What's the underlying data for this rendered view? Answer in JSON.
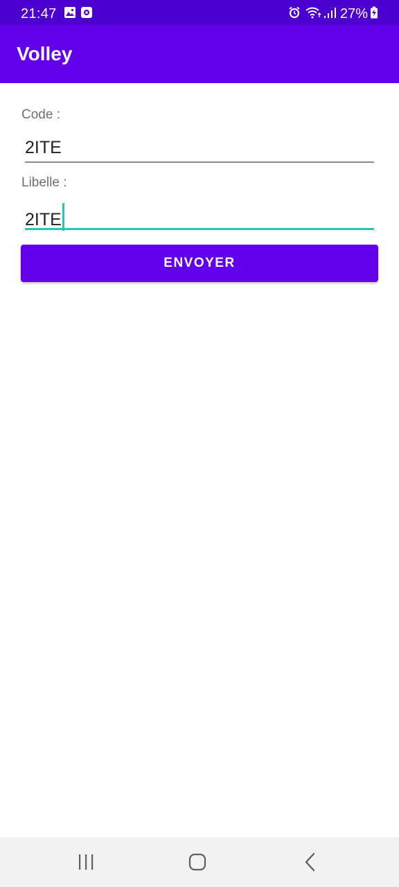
{
  "status_bar": {
    "time": "21:47",
    "battery_percent": "27%",
    "icons": [
      "gallery-icon",
      "screen-record-icon",
      "alarm-icon",
      "wifi-icon",
      "signal-icon",
      "battery-charging-icon"
    ]
  },
  "app_bar": {
    "title": "Volley"
  },
  "form": {
    "code_label": "Code :",
    "code_value": "2ITE",
    "libelle_label": "Libelle  :",
    "libelle_value": "2ITE",
    "submit_label": "ENVOYER"
  },
  "nav_bar": {
    "icons": [
      "recent-apps-icon",
      "home-icon",
      "back-icon"
    ]
  },
  "colors": {
    "primary": "#6200ee",
    "primary_dark": "#4b00cf",
    "accent": "#26c6b8",
    "background": "#ffffff",
    "nav_background": "#f2f2f2"
  }
}
